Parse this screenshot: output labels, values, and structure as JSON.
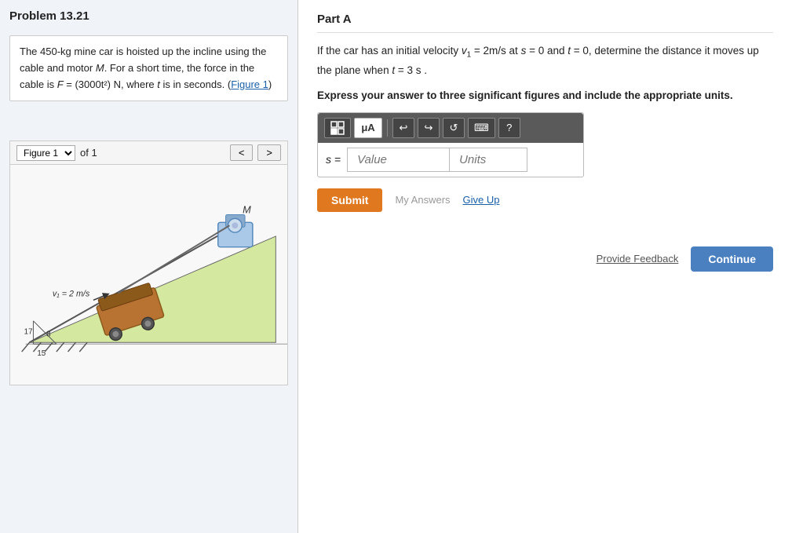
{
  "page": {
    "problem_title": "Problem 13.21",
    "description_line1": "The 450-kg mine car is hoisted up the incline using the cable and motor ",
    "description_M": "M",
    "description_line2": ". For a short time, the force in the cable is ",
    "description_F": "F",
    "description_line3": " = (3000t²) N, where ",
    "description_t": "t",
    "description_line4": " is in seconds. (",
    "figure_link": "Figure 1",
    "description_end": ")",
    "figure_label": "Figure 1",
    "figure_of": "of 1",
    "part_label": "Part A",
    "problem_text_1": "If the car has an initial velocity v₁ = 2m/s at s = 0 and t = 0, determine the distance it moves up",
    "problem_text_2": "the plane when t = 3 s .",
    "instruction": "Express your answer to three significant figures and include the appropriate units.",
    "toolbar": {
      "grid_icon": "⊞",
      "mu_symbol": "μA",
      "undo_icon": "↩",
      "redo_icon": "↪",
      "refresh_icon": "↺",
      "keyboard_icon": "⌨",
      "help_icon": "?"
    },
    "input": {
      "s_label": "s =",
      "value_placeholder": "Value",
      "units_placeholder": "Units"
    },
    "actions": {
      "submit_label": "Submit",
      "my_answers_label": "My Answers",
      "give_up_label": "Give Up"
    },
    "footer": {
      "feedback_label": "Provide Feedback",
      "continue_label": "Continue"
    },
    "figure": {
      "nav_prev": "<",
      "nav_next": ">",
      "v_label": "v₁ = 2 m/s",
      "M_label": "M",
      "num_17": "17",
      "num_8": "8",
      "num_15": "15"
    }
  }
}
